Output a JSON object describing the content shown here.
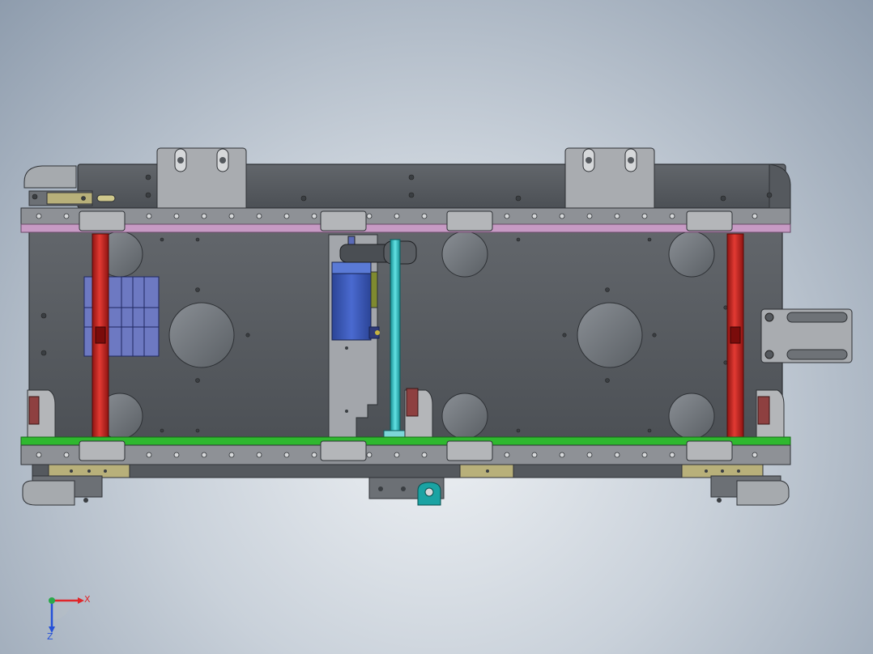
{
  "triad": {
    "x_label": "X",
    "z_label": "Z",
    "x_color": "#e0262a",
    "z_color": "#2450d8",
    "y_color": "#2aa84a"
  },
  "colors": {
    "frame": "#5a5e63",
    "frame_dark": "#3c4045",
    "plate": "#9ea2a7",
    "bracket": "#b4b6b9",
    "rail_top": "#c79ac4",
    "rail_bottom": "#2fb82f",
    "tie_rod": "#d0201e",
    "shaft": "#2ec2c6",
    "motor": "#3c5ab8",
    "block": "#6d79c2",
    "brass": "#b8b07a",
    "mount": "#1aa3a3"
  },
  "parts": [
    "frame",
    "top-rail",
    "bottom-rail",
    "tie-rod-left",
    "tie-rod-right",
    "drive-shaft",
    "motor",
    "side-bracket",
    "cam-block",
    "mounting-bracket"
  ]
}
